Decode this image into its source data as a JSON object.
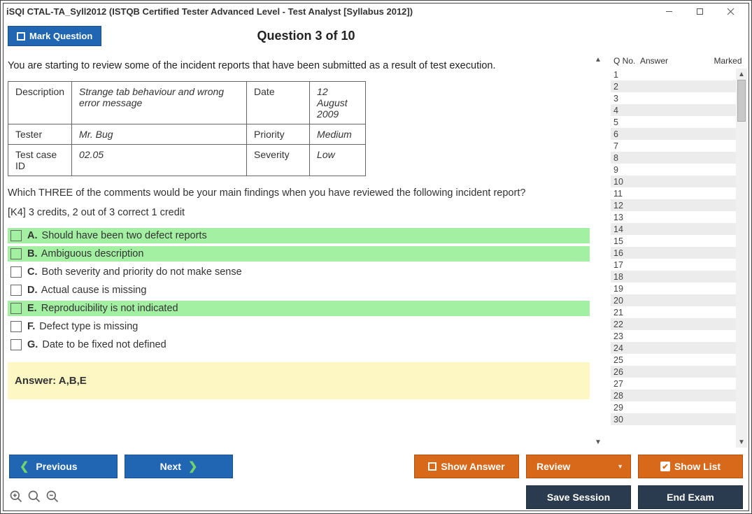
{
  "window": {
    "title": "iSQI CTAL-TA_Syll2012 (ISTQB Certified Tester Advanced Level - Test Analyst [Syllabus 2012])"
  },
  "toolbar": {
    "mark_question": "Mark Question",
    "question_title": "Question 3 of 10"
  },
  "question": {
    "intro": "You are starting to review some of the incident reports that have been submitted as a result of test execution.",
    "incident": {
      "labels": {
        "description": "Description",
        "date": "Date",
        "tester": "Tester",
        "priority": "Priority",
        "testcase": "Test case ID",
        "severity": "Severity"
      },
      "values": {
        "description": "Strange tab behaviour and wrong error message",
        "date": "12 August 2009",
        "tester": "Mr. Bug",
        "priority": "Medium",
        "testcase": "02.05",
        "severity": "Low"
      }
    },
    "prompt": "Which THREE of the comments would be your main findings when you have reviewed the following incident report?",
    "credit_note": "[K4] 3 credits, 2 out of 3 correct 1 credit",
    "options": [
      {
        "letter": "A.",
        "text": "Should have been two defect reports",
        "correct": true
      },
      {
        "letter": "B.",
        "text": "Ambiguous description",
        "correct": true
      },
      {
        "letter": "C.",
        "text": "Both severity and priority do not make sense",
        "correct": false
      },
      {
        "letter": "D.",
        "text": "Actual cause is missing",
        "correct": false
      },
      {
        "letter": "E.",
        "text": "Reproducibility is not indicated",
        "correct": true
      },
      {
        "letter": "F.",
        "text": "Defect type is missing",
        "correct": false
      },
      {
        "letter": "G.",
        "text": "Date to be fixed not defined",
        "correct": false
      }
    ],
    "answer_label": "Answer: A,B,E"
  },
  "qlist": {
    "headers": {
      "qno": "Q No.",
      "answer": "Answer",
      "marked": "Marked"
    },
    "total": 30
  },
  "buttons": {
    "previous": "Previous",
    "next": "Next",
    "show_answer": "Show Answer",
    "review": "Review",
    "show_list": "Show List",
    "save_session": "Save Session",
    "end_exam": "End Exam"
  }
}
